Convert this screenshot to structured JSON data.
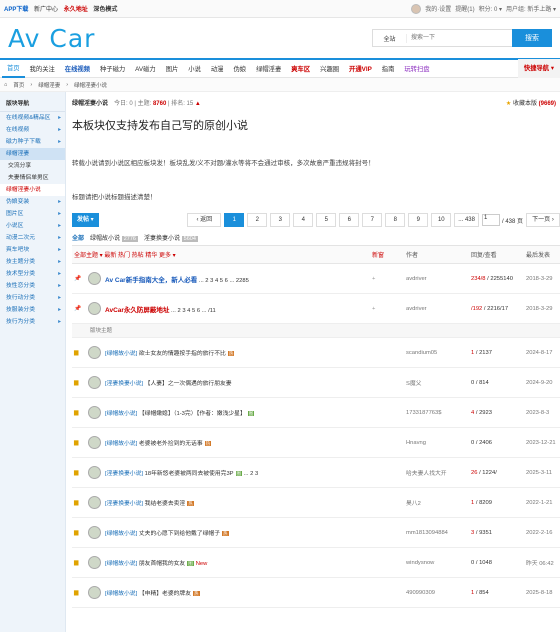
{
  "topbar": {
    "left": [
      "APP下载",
      "新广中心",
      "永久地址",
      "深色模式"
    ],
    "right": [
      "我的·设置",
      "提醒(1)",
      "积分: 0 ▾",
      "用户组: 新手上路 ▾"
    ]
  },
  "header": {
    "logo": "Av Car",
    "search_scope": "全站",
    "search_placeholder": "搜索一下",
    "search_button": "搜索"
  },
  "nav": {
    "items": [
      "首页",
      "我的关注",
      "在线视频",
      "种子磁力",
      "AV磁力",
      "图片",
      "小说",
      "动漫",
      "伪娘",
      "绿帽淫妻",
      "爽车区",
      "兴趣圈",
      "开通VIP",
      "指南",
      "玩转扫盘"
    ],
    "more": "快捷导航 ▾"
  },
  "crumb": [
    "首页",
    "绿帽淫妻",
    "绿帽淫妻小说"
  ],
  "sidebar": {
    "header": "版块导航",
    "items": [
      {
        "label": "在线视频&精品区",
        "kind": "grp"
      },
      {
        "label": "在线视频",
        "kind": "grp"
      },
      {
        "label": "磁力种子下载",
        "kind": "grp"
      },
      {
        "label": "绿帽淫妻",
        "kind": "sec"
      },
      {
        "label": "交流分享",
        "kind": "sub"
      },
      {
        "label": "夫妻情侣单男区",
        "kind": "sub"
      },
      {
        "label": "绿帽淫妻小说",
        "kind": "cur"
      },
      {
        "label": "伪娘变装",
        "kind": "grp"
      },
      {
        "label": "图片区",
        "kind": "grp"
      },
      {
        "label": "小说区",
        "kind": "grp"
      },
      {
        "label": "动漫二次元",
        "kind": "grp"
      },
      {
        "label": "爽车吧块",
        "kind": "grp"
      },
      {
        "label": "技主题分类",
        "kind": "grp"
      },
      {
        "label": "技术型分类",
        "kind": "grp"
      },
      {
        "label": "技性恋分类",
        "kind": "grp"
      },
      {
        "label": "技行动分类",
        "kind": "grp"
      },
      {
        "label": "技服装分类",
        "kind": "grp"
      },
      {
        "label": "技行为分类",
        "kind": "grp"
      }
    ]
  },
  "forum": {
    "name": "绿帽淫妻小说",
    "today": "今日: 0",
    "topics_label": "主题:",
    "topics": "8760",
    "rank_label": "排名:",
    "rank": "15",
    "fav_label": "收藏本版",
    "fav_count": "(9669)",
    "title": "本板块仅支持发布自己写的原创小说",
    "rule1": "转载小说请到小说区相应板块发！板块乱发/义不对题/灌水等将不会通过审核，多次故意严重违规将封号！",
    "rule2": "标题请把小说标题描述清楚！"
  },
  "pager": {
    "new": "发帖 ▾",
    "prev": "‹ 返回",
    "pages": [
      "1",
      "2",
      "3",
      "4",
      "5",
      "6",
      "7",
      "8",
      "9",
      "10",
      "... 438"
    ],
    "current": "1",
    "jump_val": "1",
    "total": "/ 438 页",
    "next": "下一页 ›"
  },
  "tabs": {
    "all": "全部",
    "t1": "绿帽故小说",
    "c1": "2776",
    "t2": "淫妻换妻小说",
    "c2": "5604"
  },
  "thead": {
    "left": "全部主题 ▾  最新  热门  热帖  精华  更多 ▾",
    "new": "新窗",
    "author": "作者",
    "reply": "回复/查看",
    "last": "最后发表"
  },
  "sticky": [
    {
      "title": "Av Car新手指南大全，新人必看",
      "pages": "... 2 3 4 5 6 ... 2285",
      "author": "avdriver",
      "reply": "234/8",
      "views": "2255140",
      "date": "2018-3-29",
      "style": "big"
    },
    {
      "title": "AvCar永久防屏蔽地址",
      "pages": "... 2 3 4 5 6 ... /11",
      "author": "avdriver",
      "reply": "/192",
      "views": "2216/17",
      "date": "2018-3-29",
      "style": "big2"
    }
  ],
  "sep": "版块主题",
  "threads": [
    {
      "cat": "[绿帽故小说]",
      "title": "欲士女友的情趣按手指的旅行不比",
      "author": "scandium05",
      "reply": "1",
      "views": "2137",
      "date": "2024-8-17",
      "tag": "orange"
    },
    {
      "cat": "[淫妻换妻小说]",
      "title": "【人妻】之一次偶遇的旅行朋友妻",
      "author": "S魔父",
      "reply": "0",
      "views": "814",
      "date": "2024-9-20",
      "tag": ""
    },
    {
      "cat": "[绿帽故小说]",
      "title": "【绿帽嫩媳】（1-3完）【作者：嫩浅少星】",
      "author": "1733187763$",
      "reply": "4",
      "views": "2923",
      "date": "2023-8-3",
      "tag": "green"
    },
    {
      "cat": "[绿帽故小说]",
      "title": "老婆被老外捡到的无话事",
      "author": "Hnavng",
      "reply": "0",
      "views": "2406",
      "date": "2023-12-21",
      "tag": "orange"
    },
    {
      "cat": "[淫妻换妻小说]",
      "title": "18年新悠老婆被两同去被使用完3P",
      "author": "哈夫妻人找大开",
      "reply": "26",
      "views": "1224/",
      "date": "2025-3-11",
      "tag": "green",
      "pages": "... 2 3"
    },
    {
      "cat": "[淫妻换妻小说]",
      "title": "我结老婆去卖淫",
      "author": "昊八2",
      "reply": "1",
      "views": "8209",
      "date": "2022-1-21",
      "tag": "orange"
    },
    {
      "cat": "[绿帽故小说]",
      "title": "丈夫的心愿下到给他戴了绿帽子",
      "author": "mm1813094884",
      "reply": "3",
      "views": "9351",
      "date": "2022-2-16",
      "tag": "orange"
    },
    {
      "cat": "[绿帽故小说]",
      "title": "朋友首帽我的女友",
      "author": "windysnow",
      "reply": "0",
      "views": "1048",
      "date": "昨天 06:42",
      "tag": "green",
      "new": "New"
    },
    {
      "cat": "[绿帽故小说]",
      "title": "【申精】老婆的牌友",
      "author": "490990309",
      "reply": "1",
      "views": "854",
      "date": "2025-8-18",
      "tag": "orange"
    }
  ],
  "colors": {
    "accent": "#1a8fdb",
    "red": "#cc0000"
  }
}
